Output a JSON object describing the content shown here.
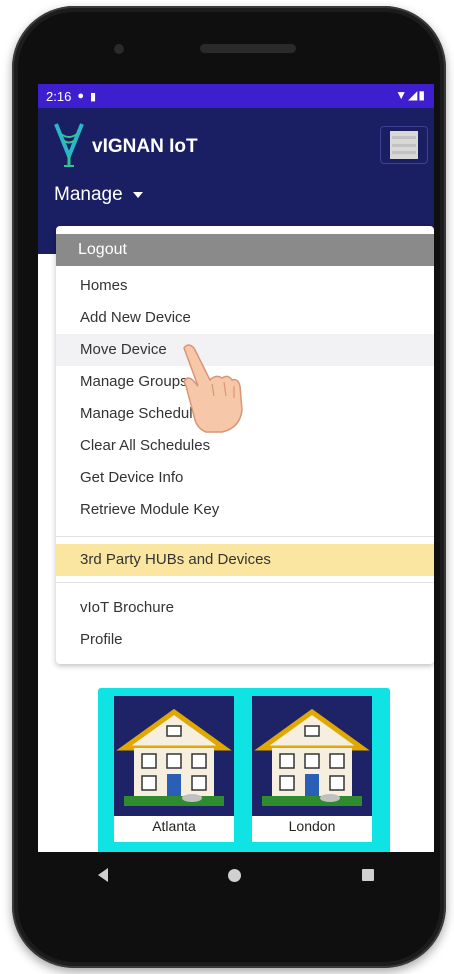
{
  "status_bar": {
    "time": "2:16",
    "icons_left": [
      "sync-icon",
      "sd-card-icon"
    ],
    "icons_right": [
      "wifi-icon",
      "signal-icon",
      "battery-icon"
    ]
  },
  "app": {
    "brand": "vIGNAN IoT",
    "manage_label": "Manage"
  },
  "dropdown": {
    "logout": "Logout",
    "items": [
      "Homes",
      "Add New Device",
      "Move Device",
      "Manage Groups",
      "Manage Schedules",
      "Clear All Schedules",
      "Get Device Info",
      "Retrieve Module Key"
    ],
    "highlighted_item": "3rd Party HUBs and Devices",
    "footer_items": [
      "vIoT Brochure",
      "Profile"
    ]
  },
  "homes": [
    {
      "name": "Atlanta"
    },
    {
      "name": "London"
    }
  ],
  "colors": {
    "status_bar": "#3d1fd0",
    "app_bar": "#1a1e63",
    "logout_bg": "#8a8a8a",
    "highlight_bg": "#fbe6a1",
    "tiles_frame": "#10e3e3"
  }
}
